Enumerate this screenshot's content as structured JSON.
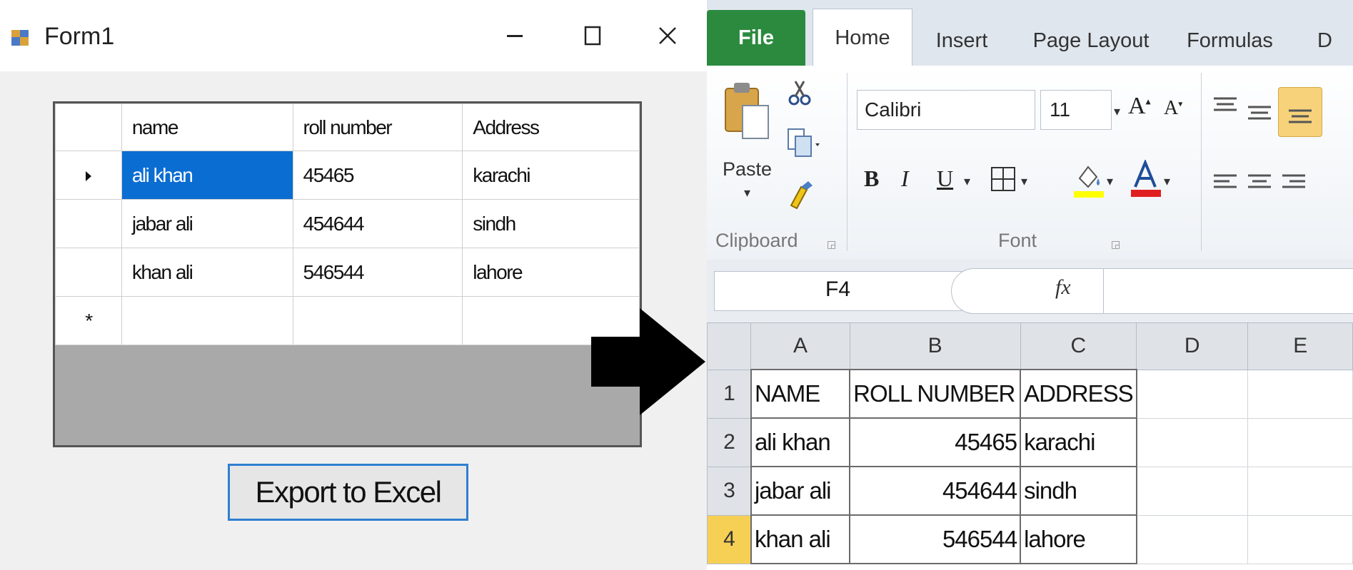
{
  "form": {
    "title": "Form1",
    "grid": {
      "columns": [
        "name",
        "roll number",
        "Address"
      ],
      "rows": [
        [
          "ali khan",
          "45465",
          "karachi"
        ],
        [
          "jabar ali",
          "454644",
          "sindh"
        ],
        [
          "khan ali",
          "546544",
          "lahore"
        ]
      ],
      "new_row_marker": "*"
    },
    "export_button": "Export to Excel"
  },
  "excel": {
    "tabs": [
      "File",
      "Home",
      "Insert",
      "Page Layout",
      "Formulas",
      "D"
    ],
    "ribbon": {
      "paste_label": "Paste",
      "clipboard_label": "Clipboard",
      "font_label": "Font",
      "font_name": "Calibri",
      "font_size": "11",
      "bold": "B",
      "italic": "I",
      "underline": "U"
    },
    "name_box": "F4",
    "fx": "fx",
    "columns": [
      "A",
      "B",
      "C",
      "D",
      "E"
    ],
    "row_numbers": [
      "1",
      "2",
      "3",
      "4"
    ],
    "cells": [
      [
        "NAME",
        "ROLL NUMBER",
        "ADDRESS"
      ],
      [
        "ali khan",
        "45465",
        "karachi"
      ],
      [
        "jabar ali",
        "454644",
        "sindh"
      ],
      [
        "khan ali",
        "546544",
        "lahore"
      ]
    ]
  }
}
